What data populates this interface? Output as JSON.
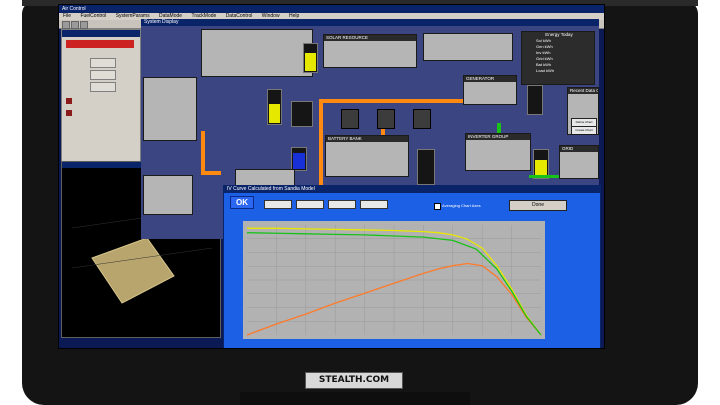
{
  "window": {
    "title": "Air Control",
    "menu": [
      "File",
      "FuelControl",
      "SystemParams",
      "DataMode",
      "TrackMode",
      "DataControl",
      "Window",
      "Help"
    ]
  },
  "dashboard": {
    "title": "System Display",
    "solar_resource": "SOLAR RESOURCE",
    "generator": "GENERATOR",
    "inverter": "INVERTER GROUP",
    "battery_bank": "BATTERY BANK",
    "grid": "GRID",
    "load": "LOAD"
  },
  "energy_today": {
    "title": "Energy Today",
    "rows": [
      "Sol kWh",
      "Gen kWh",
      "Inv kWh",
      "Grid kWh",
      "Bat kWh",
      "Load kWh"
    ]
  },
  "recent_data": {
    "title": "Recent Data Charts",
    "define_chart": "Define Chart",
    "create_chart": "Create Chart"
  },
  "chart_window": {
    "title": "IV Curve Calculated from Sandia Model",
    "ok_label": "OK",
    "average_label": "Averaging Chart Axes",
    "done_label": "Done"
  },
  "brand": "STEALTH.COM",
  "colors": {
    "pipe": "#ff8a12",
    "green_line": "#19c219",
    "chart_bg": "#1c60e6"
  },
  "chart_data": {
    "type": "line",
    "title": "",
    "xlabel": "",
    "ylabel": "",
    "series": [
      {
        "x": [
          0,
          0.1,
          0.2,
          0.3,
          0.4,
          0.5,
          0.6,
          0.65,
          0.7,
          0.75,
          0.8,
          0.85,
          0.9,
          0.95,
          1.0
        ],
        "values": [
          0.97,
          0.97,
          0.965,
          0.96,
          0.955,
          0.95,
          0.94,
          0.93,
          0.91,
          0.87,
          0.79,
          0.63,
          0.42,
          0.18,
          0.0
        ]
      },
      {
        "x": [
          0,
          0.1,
          0.2,
          0.3,
          0.4,
          0.5,
          0.6,
          0.65,
          0.7,
          0.75,
          0.8,
          0.85,
          0.9,
          0.95,
          1.0
        ],
        "values": [
          0.0,
          0.1,
          0.19,
          0.29,
          0.38,
          0.47,
          0.56,
          0.6,
          0.63,
          0.65,
          0.63,
          0.53,
          0.37,
          0.16,
          0.0
        ]
      },
      {
        "x": [
          0,
          0.1,
          0.2,
          0.3,
          0.4,
          0.5,
          0.6,
          0.7,
          0.78,
          0.85,
          0.9,
          0.95,
          1.0
        ],
        "values": [
          0.93,
          0.925,
          0.92,
          0.915,
          0.91,
          0.9,
          0.89,
          0.86,
          0.78,
          0.6,
          0.4,
          0.17,
          0.0
        ]
      }
    ],
    "xlim": [
      0,
      1
    ],
    "ylim": [
      0,
      1
    ]
  }
}
